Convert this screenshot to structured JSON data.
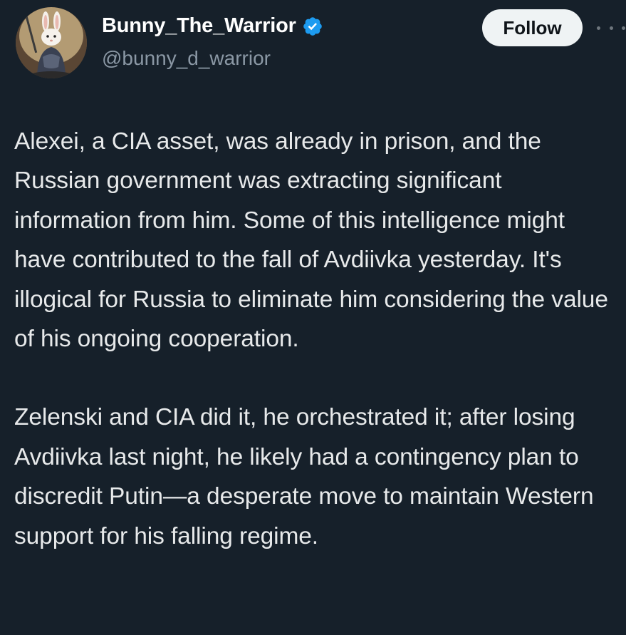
{
  "author": {
    "display_name": "Bunny_The_Warrior",
    "handle": "@bunny_d_warrior",
    "verified": true,
    "avatar_icon": "armored-bunny-avatar"
  },
  "actions": {
    "follow_label": "Follow",
    "more_icon": "more-horizontal-icon"
  },
  "colors": {
    "background": "#16202a",
    "text": "#e7e9ea",
    "secondary_text": "#8b98a5",
    "verified_badge": "#1d9bf0",
    "follow_button_bg": "#eff3f4"
  },
  "tweet": {
    "paragraphs": [
      "Alexei, a CIA asset, was already in prison, and the Russian government was extracting significant information from him. Some of this intelligence might have contributed to the fall of Avdiivka yesterday. It's illogical for Russia to eliminate him considering the value of his ongoing cooperation.",
      "Zelenski and CIA did it, he orchestrated it; after losing Avdiivka last night, he likely had a contingency plan to discredit Putin—a desperate move to maintain Western support for his falling regime."
    ]
  }
}
